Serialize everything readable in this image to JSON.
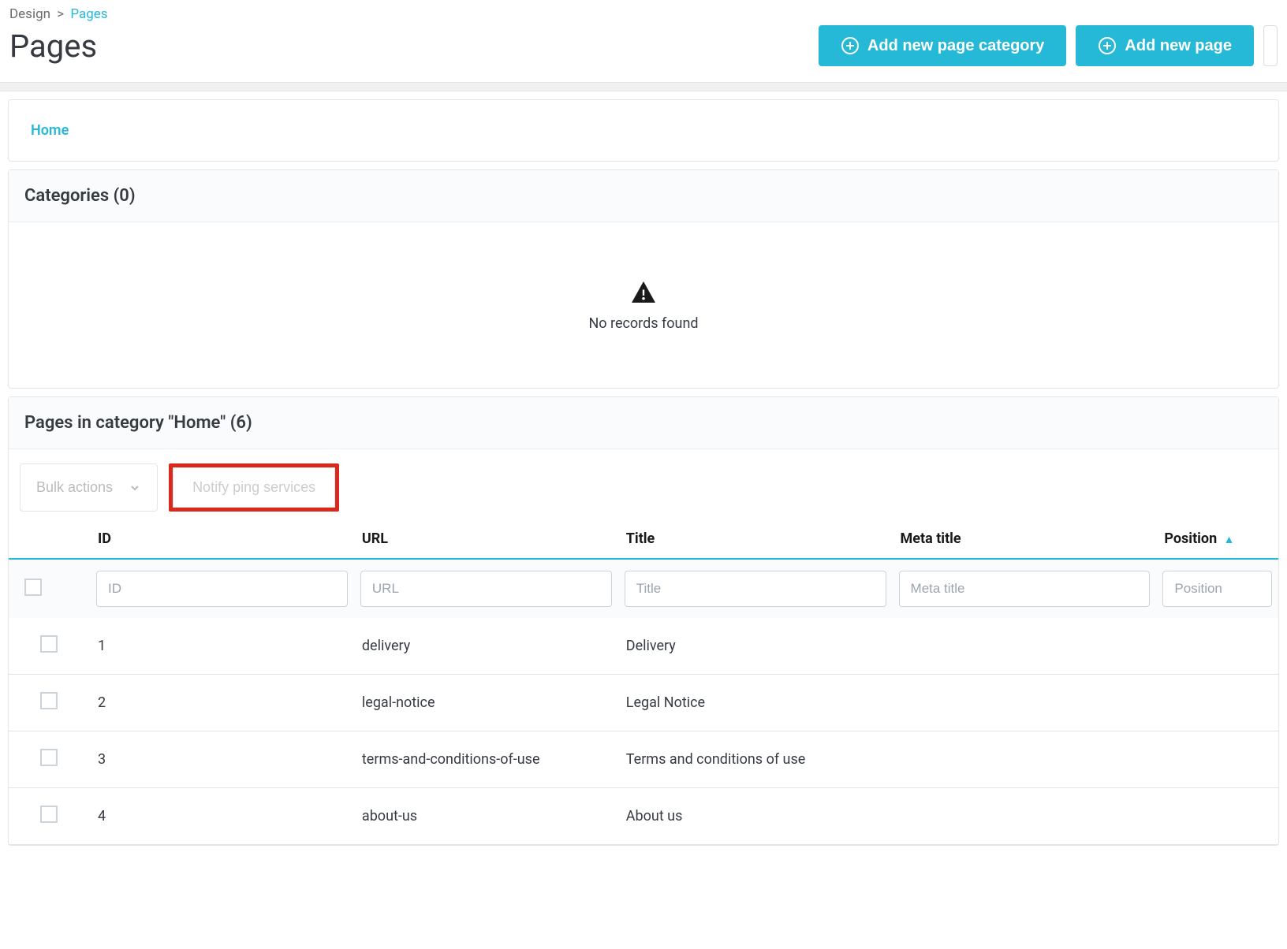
{
  "breadcrumb": {
    "root": "Design",
    "sep": ">",
    "current": "Pages"
  },
  "page_title": "Pages",
  "buttons": {
    "add_category": "Add new page category",
    "add_page": "Add new page",
    "bulk_actions": "Bulk actions",
    "notify": "Notify ping services"
  },
  "home_tab": "Home",
  "categories_panel_title": "Categories (0)",
  "empty_text": "No records found",
  "pages_panel_title": "Pages in category \"Home\" (6)",
  "columns": {
    "id": "ID",
    "url": "URL",
    "title": "Title",
    "meta": "Meta title",
    "position": "Position"
  },
  "filter_placeholders": {
    "id": "ID",
    "url": "URL",
    "title": "Title",
    "meta": "Meta title",
    "position": "Position"
  },
  "rows": [
    {
      "id": "1",
      "url": "delivery",
      "title": "Delivery",
      "meta": ""
    },
    {
      "id": "2",
      "url": "legal-notice",
      "title": "Legal Notice",
      "meta": ""
    },
    {
      "id": "3",
      "url": "terms-and-conditions-of-use",
      "title": "Terms and conditions of use",
      "meta": ""
    },
    {
      "id": "4",
      "url": "about-us",
      "title": "About us",
      "meta": ""
    }
  ]
}
